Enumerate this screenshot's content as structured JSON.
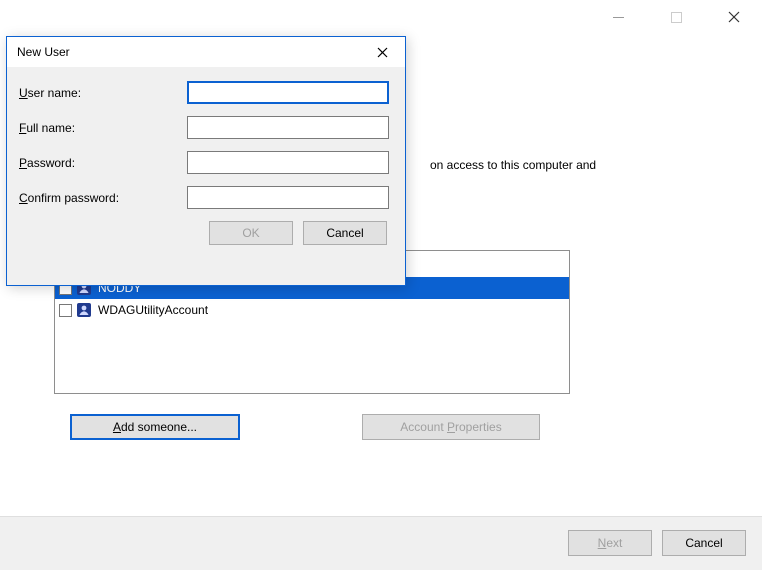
{
  "parent_window": {
    "helper_text": "on access to this computer and",
    "add_button_prefix": "A",
    "add_button_rest": "dd someone...",
    "acct_props_prefix": "Account ",
    "acct_props_u": "P",
    "acct_props_rest": "roperties",
    "next_u": "N",
    "next_rest": "ext",
    "cancel": "Cancel",
    "users": [
      {
        "name": "NODDY",
        "selected": true,
        "checked": false
      },
      {
        "name": "WDAGUtilityAccount",
        "selected": false,
        "checked": false
      }
    ]
  },
  "dialog": {
    "title": "New User",
    "labels": {
      "username_u": "U",
      "username_rest": "ser name:",
      "fullname_u": "F",
      "fullname_rest": "ull name:",
      "password_u": "P",
      "password_rest": "assword:",
      "confirm_u": "C",
      "confirm_rest": "onfirm password:"
    },
    "values": {
      "username": "",
      "fullname": "",
      "password": "",
      "confirm": ""
    },
    "ok": "OK",
    "cancel": "Cancel"
  }
}
